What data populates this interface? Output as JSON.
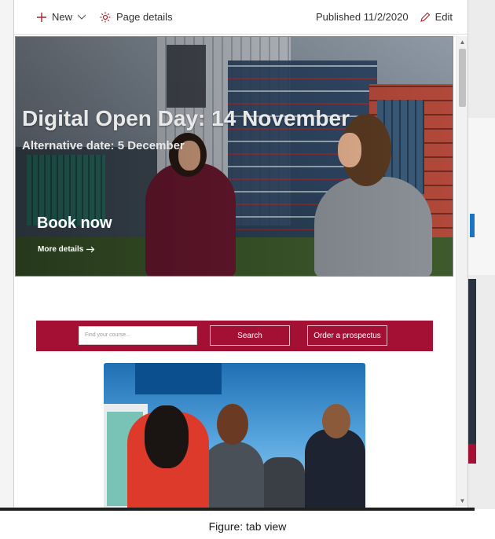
{
  "command_bar": {
    "new_label": "New",
    "page_details_label": "Page details",
    "published_text": "Published 11/2/2020",
    "edit_label": "Edit"
  },
  "hero": {
    "title": "Digital Open Day: 14 November",
    "subtitle": "Alternative date: 5 December",
    "cta_label": "Book now",
    "more_details_label": "More details"
  },
  "course_search": {
    "placeholder": "Find your course...",
    "search_label": "Search",
    "prospectus_label": "Order a prospectus"
  },
  "caption": "Figure: tab view",
  "colors": {
    "brand": "#a41034",
    "text": "#323130"
  },
  "icons": [
    "plus-icon",
    "chevron-down-icon",
    "gear-icon",
    "pencil-icon",
    "arrow-right-icon"
  ]
}
